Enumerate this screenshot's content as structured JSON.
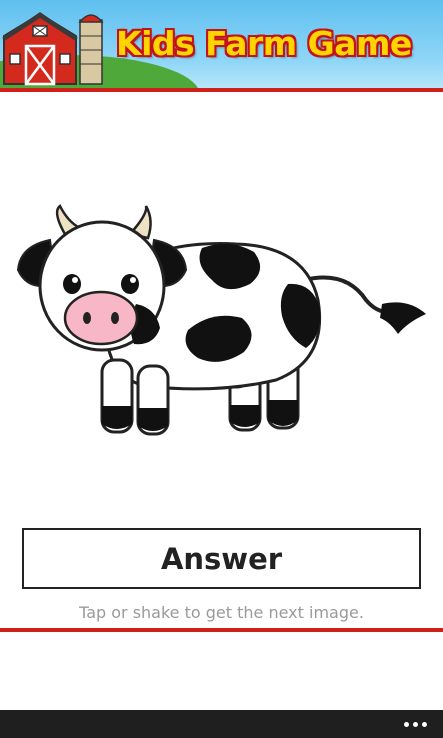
{
  "header": {
    "title": "Kids Farm Game"
  },
  "image": {
    "subject": "cow"
  },
  "answer_button": {
    "label": "Answer"
  },
  "hint": {
    "text": "Tap or shake to get the next image."
  },
  "app_bar": {
    "more_icon": "ellipsis-icon"
  },
  "colors": {
    "accent_red": "#d0201a",
    "title_yellow": "#ffd400",
    "sky_blue": "#5fc0ef",
    "app_bar": "#1f1f1f"
  }
}
